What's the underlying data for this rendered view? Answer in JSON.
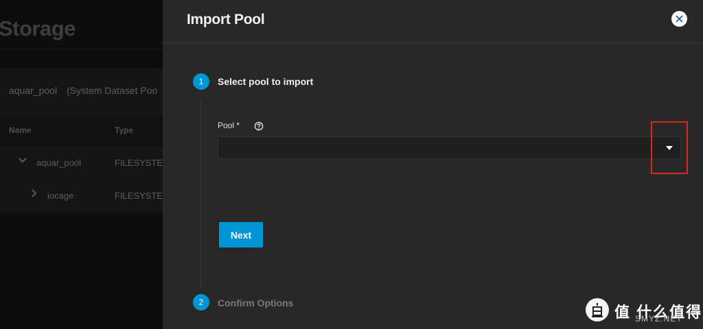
{
  "background": {
    "page_title": "Storage",
    "pool_name": "aquar_pool",
    "pool_note": "(System Dataset Poo",
    "columns": [
      "Name",
      "Type"
    ],
    "rows": [
      {
        "name": "aquar_pool",
        "type": "FILESYSTE",
        "expanded": true
      },
      {
        "name": "iocage",
        "type": "FILESYSTE",
        "expanded": false
      }
    ]
  },
  "dialog": {
    "title": "Import Pool",
    "close_icon": "close-icon",
    "steps": [
      {
        "number": "1",
        "label": "Select pool to import",
        "active": true
      },
      {
        "number": "2",
        "label": "Confirm Options",
        "active": false
      }
    ],
    "pool_field": {
      "label": "Pool *",
      "value": "",
      "help_icon": "help-circle-icon",
      "dropdown_icon": "caret-down-icon"
    },
    "next_label": "Next"
  },
  "colors": {
    "accent": "#0095d5",
    "dialog_bg": "#282828",
    "page_bg": "#101010",
    "highlight": "#e0261e"
  },
  "watermark": {
    "text": "值 什么值得买",
    "sub": "SMYZ.NET"
  }
}
